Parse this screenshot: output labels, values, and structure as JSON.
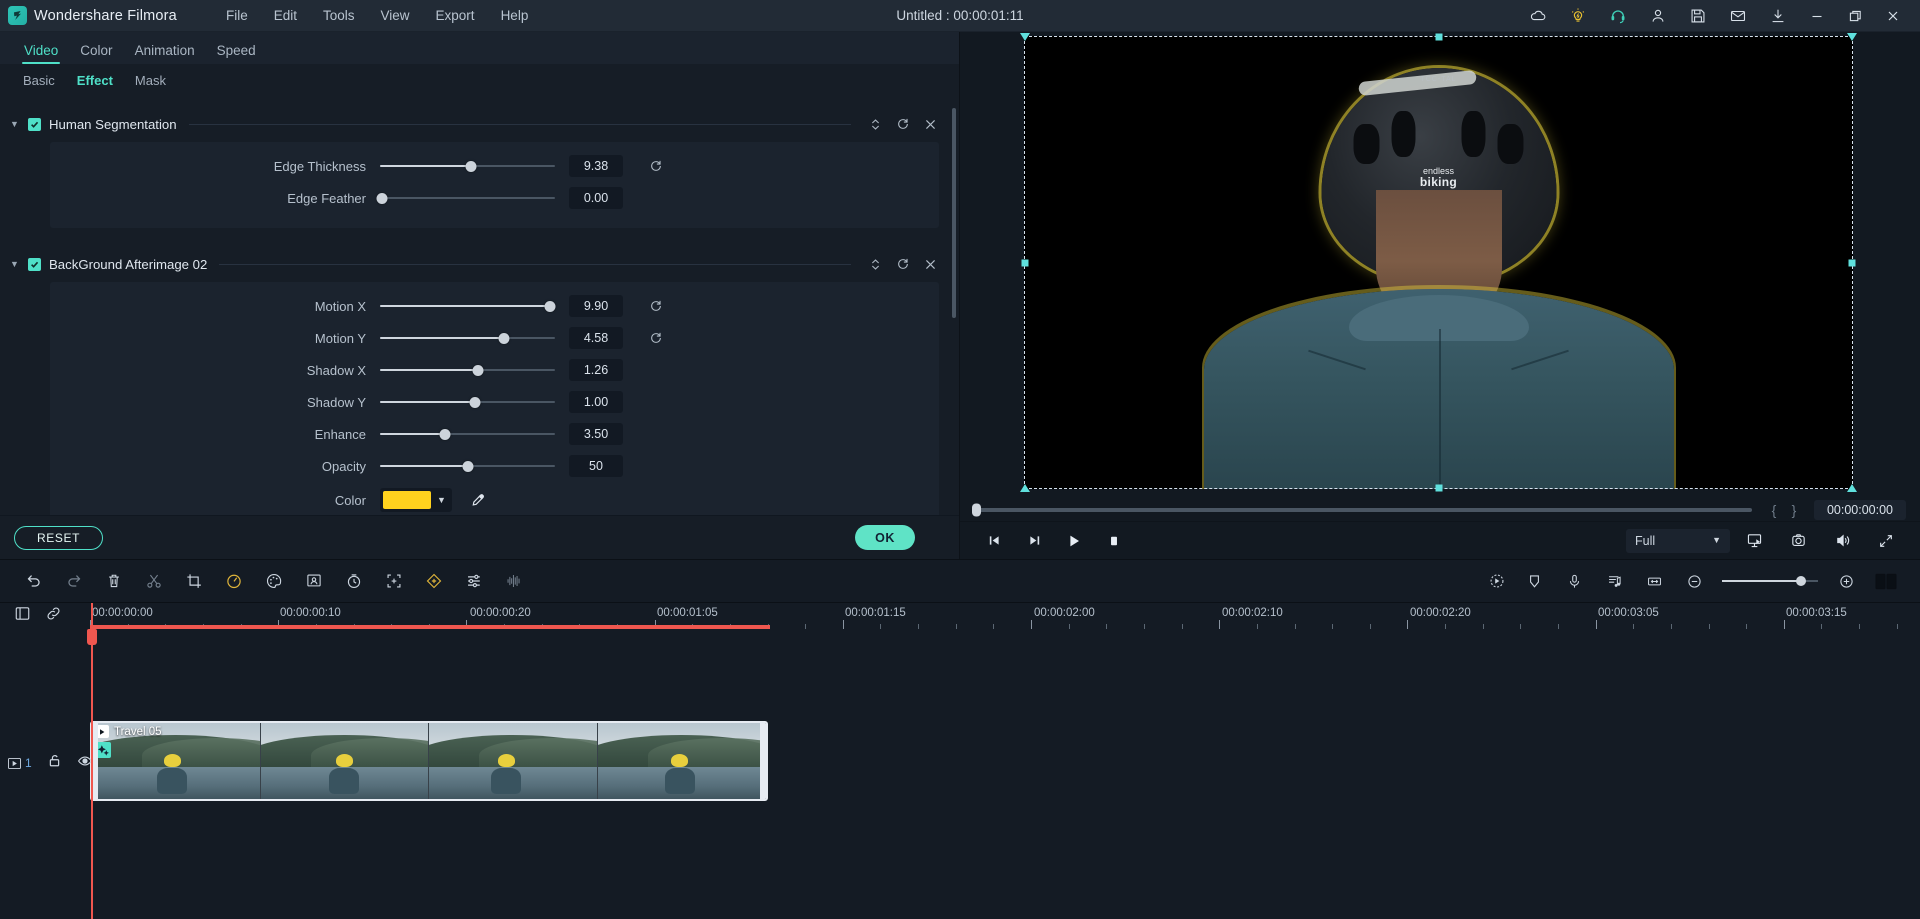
{
  "titlebar": {
    "brand": "Wondershare Filmora",
    "menus": [
      "File",
      "Edit",
      "Tools",
      "View",
      "Export",
      "Help"
    ],
    "project_title": "Untitled : 00:00:01:11",
    "icons": [
      {
        "name": "cloud-icon",
        "color": "#d8e0e9"
      },
      {
        "name": "lightbulb-icon",
        "color": "#e8c031"
      },
      {
        "name": "headset-support-icon",
        "color": "#3fd0b8"
      },
      {
        "name": "user-account-icon",
        "color": "#d8e0e9"
      },
      {
        "name": "save-icon",
        "color": "#d8e0e9"
      },
      {
        "name": "mail-icon",
        "color": "#d8e0e9"
      },
      {
        "name": "download-icon",
        "color": "#d8e0e9"
      }
    ],
    "window_buttons": [
      "minimize-icon",
      "maximize-icon",
      "close-icon"
    ]
  },
  "panel": {
    "top_tabs": [
      {
        "label": "Video",
        "active": true
      },
      {
        "label": "Color",
        "active": false
      },
      {
        "label": "Animation",
        "active": false
      },
      {
        "label": "Speed",
        "active": false
      }
    ],
    "sub_tabs": [
      {
        "label": "Basic",
        "active": false
      },
      {
        "label": "Effect",
        "active": true
      },
      {
        "label": "Mask",
        "active": false
      }
    ],
    "effects": [
      {
        "name": "Human Segmentation",
        "enabled": true,
        "expanded": true,
        "params": [
          {
            "label": "Edge Thickness",
            "value": "9.38",
            "fill_pct": 52,
            "has_reset": true
          },
          {
            "label": "Edge Feather",
            "value": "0.00",
            "fill_pct": 1,
            "has_reset": false
          }
        ]
      },
      {
        "name": "BackGround Afterimage 02",
        "enabled": true,
        "expanded": true,
        "params": [
          {
            "label": "Motion X",
            "value": "9.90",
            "fill_pct": 97,
            "has_reset": true
          },
          {
            "label": "Motion Y",
            "value": "4.58",
            "fill_pct": 71,
            "has_reset": true
          },
          {
            "label": "Shadow X",
            "value": "1.26",
            "fill_pct": 56,
            "has_reset": false
          },
          {
            "label": "Shadow Y",
            "value": "1.00",
            "fill_pct": 54,
            "has_reset": false
          },
          {
            "label": "Enhance",
            "value": "3.50",
            "fill_pct": 37,
            "has_reset": false
          },
          {
            "label": "Opacity",
            "value": "50",
            "fill_pct": 50,
            "has_reset": false
          }
        ],
        "color_param": {
          "label": "Color",
          "swatch_hex": "#FFD21E"
        }
      }
    ],
    "reset_label": "RESET",
    "ok_label": "OK"
  },
  "player": {
    "timecode": "00:00:00:00",
    "mark_in": "{",
    "mark_out": "}",
    "quality_label": "Full",
    "controls": [
      {
        "name": "previous-frame-button"
      },
      {
        "name": "next-frame-button"
      },
      {
        "name": "play-button"
      },
      {
        "name": "stop-button"
      }
    ],
    "right_controls": [
      {
        "name": "snapshot-to-project-icon"
      },
      {
        "name": "camera-snapshot-icon"
      },
      {
        "name": "volume-icon"
      },
      {
        "name": "fullscreen-icon"
      }
    ]
  },
  "timeline_toolbar": {
    "left_icons": [
      "undo-icon",
      "redo-icon",
      "delete-icon",
      "split-scissors-icon",
      "crop-icon",
      "speed-icon",
      "color-palette-icon",
      "green-screen-icon",
      "freeze-frame-icon",
      "auto-reframe-icon",
      "keyframe-diamond-icon",
      "audio-mixer-icon",
      "audio-waveform-icon"
    ],
    "right_icons": [
      "render-preview-icon",
      "marker-icon",
      "voiceover-icon",
      "auto-beat-sync-icon",
      "fit-to-timeline-icon"
    ],
    "zoom_out_icon": "zoom-out-icon",
    "zoom_in_icon": "zoom-in-icon",
    "zoom_pct": 82,
    "split_view_icon": "split-view-icon"
  },
  "timeline": {
    "ruler_labels": [
      "00:00:00:00",
      "00:00:00:10",
      "00:00:00:20",
      "00:00:01:05",
      "00:00:01:15",
      "00:00:02:00",
      "00:00:02:10",
      "00:00:02:20",
      "00:00:03:05",
      "00:00:03:15"
    ],
    "track": {
      "number": "1",
      "lock_icon": "unlock-icon",
      "visibility_icon": "eye-icon"
    },
    "clip": {
      "name": "Travel 05",
      "effects_badge": "effects-applied-badge",
      "play_badge": "video-clip-icon",
      "thumbnail_count": 4
    }
  },
  "colors": {
    "accent_teal": "#4fe0c8",
    "playhead_red": "#f0574f",
    "warn_yellow": "#e8c031",
    "panel_bg": "#161d26",
    "titlebar_bg": "#222b36"
  }
}
